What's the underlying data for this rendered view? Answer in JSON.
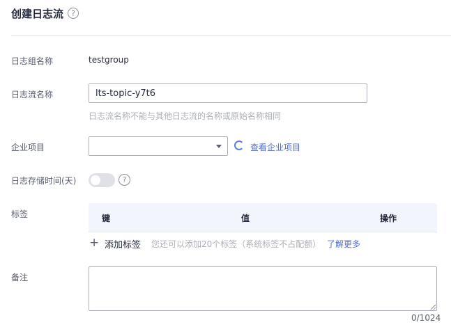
{
  "header": {
    "title": "创建日志流",
    "help_glyph": "?"
  },
  "form": {
    "log_group": {
      "label": "日志组名称",
      "value": "testgroup"
    },
    "log_stream": {
      "label": "日志流名称",
      "value": "lts-topic-y7t6",
      "hint": "日志流名称不能与其他日志流的名称或原始名称相同"
    },
    "enterprise_project": {
      "label": "企业项目",
      "selected": "",
      "link": "查看企业项目"
    },
    "retention": {
      "label": "日志存储时间(天)",
      "enabled": false,
      "help_glyph": "?"
    },
    "tags": {
      "label": "标签",
      "columns": [
        "键",
        "值",
        "操作"
      ],
      "add_icon": "+",
      "add_label": "添加标签",
      "add_hint": "您还可以添加20个标签（系统标签不占配额）",
      "learn_more": "了解更多"
    },
    "remark": {
      "label": "备注",
      "value": "",
      "counter": "0/1024"
    }
  },
  "colors": {
    "accent": "#526ecc",
    "border": "#adb0b8",
    "muted": "#adb0b8",
    "table_header": "#f2f5fc"
  },
  "icons": {
    "title_help": "question-circle-icon",
    "retention_help": "question-circle-icon",
    "select": "chevron-down-icon",
    "loading": "spinner-icon",
    "add": "plus-icon"
  }
}
